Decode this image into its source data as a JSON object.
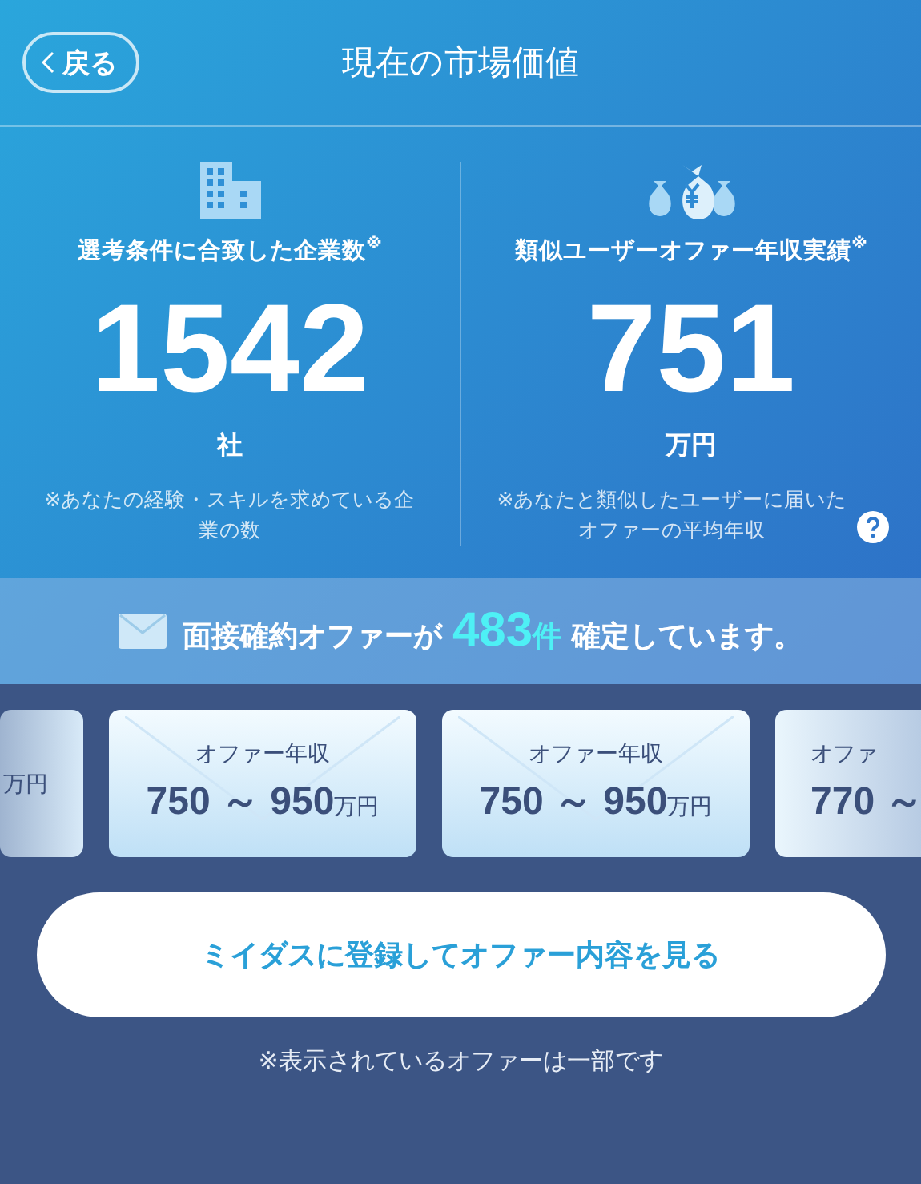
{
  "header": {
    "back_label": "戻る",
    "title": "現在の市場価値"
  },
  "stats": [
    {
      "kind": "companies",
      "label": "選考条件に合致した企業数$^{※}$",
      "value": "1542",
      "unit": "社",
      "note": "※あなたの経験・スキルを求めている企業の数",
      "help": false
    },
    {
      "kind": "salary",
      "label": "類似ユーザーオファー年収実績$^{※}$",
      "value": "751",
      "unit": "万円",
      "note": "※あなたと類似したユーザーに届いたオファーの平均年収",
      "help": true
    }
  ],
  "banner": {
    "before": "面接確約オファーが",
    "count": "483",
    "count_unit": "件",
    "after": "確定しています。"
  },
  "offers": [
    {
      "kind": "cut-left",
      "unit": "万円"
    },
    {
      "kind": "full",
      "title": "オファー年収",
      "range": "750 ～ 950",
      "unit": "万円"
    },
    {
      "kind": "full",
      "title": "オファー年収",
      "range": "750 ～ 950",
      "unit": "万円"
    },
    {
      "kind": "cut-right",
      "title": "オファ",
      "range": "770 ～"
    }
  ],
  "cta": "ミイダスに登録してオファー内容を見る",
  "footnote": "※表示されているオファーは一部です"
}
